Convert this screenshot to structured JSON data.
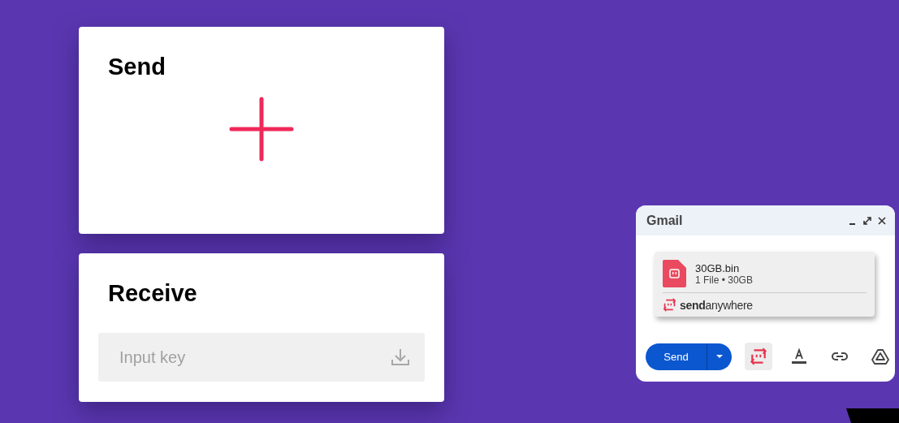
{
  "send_card": {
    "title": "Send"
  },
  "receive_card": {
    "title": "Receive",
    "key_field": {
      "placeholder": "Input key"
    }
  },
  "gmail_window": {
    "title": "Gmail",
    "attachment": {
      "file_name": "30GB.bin",
      "details": "1 File • 30GB",
      "brand": "**send**anywhere"
    },
    "send_button": {
      "label": "Send"
    },
    "tools": [
      {
        "kind": "sendanywhere",
        "selected": true
      },
      {
        "kind": "format",
        "selected": false
      },
      {
        "kind": "link",
        "selected": false
      },
      {
        "kind": "drive",
        "selected": false
      }
    ]
  }
}
